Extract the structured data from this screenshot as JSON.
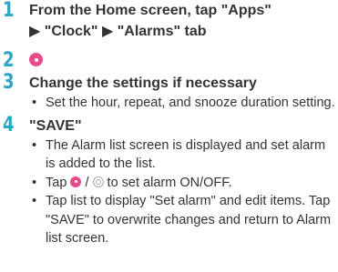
{
  "steps": [
    {
      "number": "1",
      "title_lines": [
        "From the Home screen, tap \"Apps\"",
        "▶ \"Clock\" ▶ \"Alarms\" tab"
      ]
    },
    {
      "number": "2",
      "icon": "add-alarm-icon"
    },
    {
      "number": "3",
      "title": "Change the settings if necessary",
      "bullets": [
        "Set the hour, repeat, and snooze duration setting."
      ]
    },
    {
      "number": "4",
      "title": "\"SAVE\"",
      "bullets": [
        "The Alarm list screen is displayed and set alarm is added to the list.",
        {
          "before": "Tap ",
          "separator": " / ",
          "after": " to set alarm ON/OFF.",
          "icons": [
            "alarm-on-icon",
            "alarm-off-icon"
          ]
        },
        "Tap list to display \"Set alarm\" and edit items. Tap \"SAVE\" to overwrite changes and return to Alarm list screen."
      ]
    }
  ],
  "colors": {
    "step_number": "#2aa6c4",
    "icon_pink": "#e94a8a",
    "text": "#333333"
  },
  "bullet_char": "•"
}
